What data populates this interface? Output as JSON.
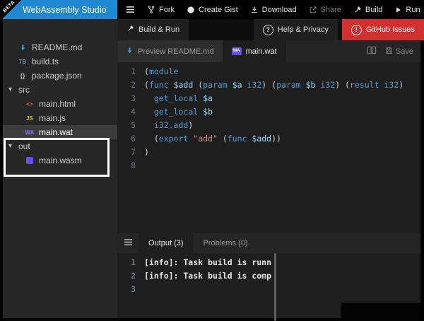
{
  "app": {
    "title": "WebAssembly Studio",
    "beta": "BETA"
  },
  "colors": {
    "accent_blue": "#1e88d2",
    "wasm_purple": "#654ff0",
    "issues_red": "#d32f2f"
  },
  "toolbar": {
    "fork": "Fork",
    "create_gist": "Create Gist",
    "download": "Download",
    "share": "Share",
    "build": "Build",
    "run": "Run"
  },
  "secondary": {
    "build_run": "Build & Run",
    "help": "Help & Privacy",
    "help_glyph": "?",
    "issues": "GitHub Issues",
    "issues_glyph": "!"
  },
  "explorer": {
    "items": [
      {
        "name": "README.md"
      },
      {
        "name": "build.ts"
      },
      {
        "name": "package.json"
      },
      {
        "name": "src"
      },
      {
        "name": "main.html"
      },
      {
        "name": "main.js"
      },
      {
        "name": "main.wat"
      },
      {
        "name": "out"
      },
      {
        "name": "main.wasm"
      }
    ],
    "icon_glyphs": {
      "ts": "TS",
      "json": "{}",
      "html": "<>",
      "js": "JS",
      "wat": "WA",
      "arrow": "▾"
    }
  },
  "editor": {
    "tabs": [
      {
        "label": "Preview README.md"
      },
      {
        "label": "main.wat"
      }
    ],
    "wat_badge": "WA",
    "save": "Save",
    "lines": [
      {
        "n": "1",
        "code": "(module"
      },
      {
        "n": "2",
        "code": "(func $add (param $a i32) (param $b i32) (result i32)"
      },
      {
        "n": "3",
        "code": "  get_local $a"
      },
      {
        "n": "4",
        "code": "  get_local $b"
      },
      {
        "n": "5",
        "code": "  i32.add)"
      },
      {
        "n": "6",
        "code": "  (export \"add\" (func $add))"
      },
      {
        "n": "7",
        "code": ")"
      },
      {
        "n": "8",
        "code": ""
      }
    ]
  },
  "panel": {
    "tabs": [
      {
        "label": "Output (3)"
      },
      {
        "label": "Problems (0)"
      }
    ],
    "lines": [
      {
        "n": "1",
        "text": "[info]: Task build is runn"
      },
      {
        "n": "2",
        "text": "[info]: Task build is comp"
      },
      {
        "n": "3",
        "text": ""
      }
    ]
  }
}
